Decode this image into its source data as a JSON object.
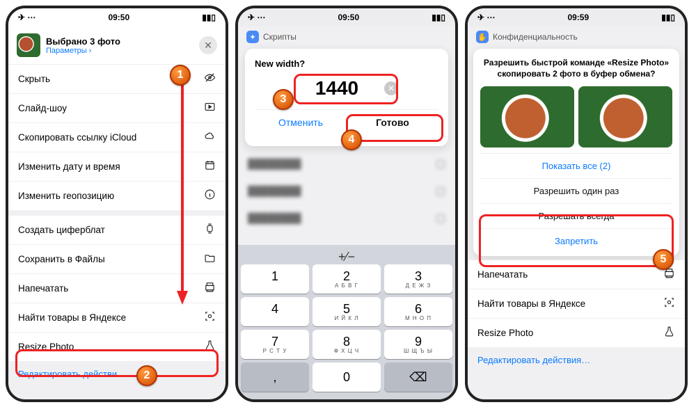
{
  "status": {
    "time1": "09:50",
    "time2": "09:50",
    "time3": "09:59"
  },
  "p1": {
    "title": "Выбрано 3 фото",
    "params": "Параметры ›",
    "rows": {
      "hide": "Скрыть",
      "slideshow": "Слайд-шоу",
      "icloud": "Скопировать ссылку iCloud",
      "datetime": "Изменить дату и время",
      "geo": "Изменить геопозицию",
      "watchface": "Создать циферблат",
      "files": "Сохранить в Файлы",
      "print": "Напечатать",
      "yandex": "Найти товары в Яндексе",
      "resize": "Resize Photo"
    },
    "edit": "Редактировать действи"
  },
  "p2": {
    "scripts": "Скрипты",
    "question": "New width?",
    "value": "1440",
    "cancel": "Отменить",
    "done": "Готово",
    "keys": {
      "k2l": "А Б В Г",
      "k3l": "Д Е Ж З",
      "k5l": "И Й К Л",
      "k6l": "М Н О П",
      "k7l": "Р С Т У",
      "k8l": "Ф Х Ц Ч",
      "k9l": "Ш Щ Ъ Ы"
    }
  },
  "p3": {
    "priv": "Конфиденциальность",
    "question": "Разрешить быстрой команде «Resize Photo» скопировать 2 фото в буфер обмена?",
    "showall": "Показать все (2)",
    "once": "Разрешить один раз",
    "always": "Разрешать всегда",
    "deny": "Запретить",
    "print": "Напечатать",
    "yandex": "Найти товары в Яндексе",
    "resize": "Resize Photo",
    "edit": "Редактировать действия…"
  },
  "markers": {
    "m1": "1",
    "m2": "2",
    "m3": "3",
    "m4": "4",
    "m5": "5"
  }
}
